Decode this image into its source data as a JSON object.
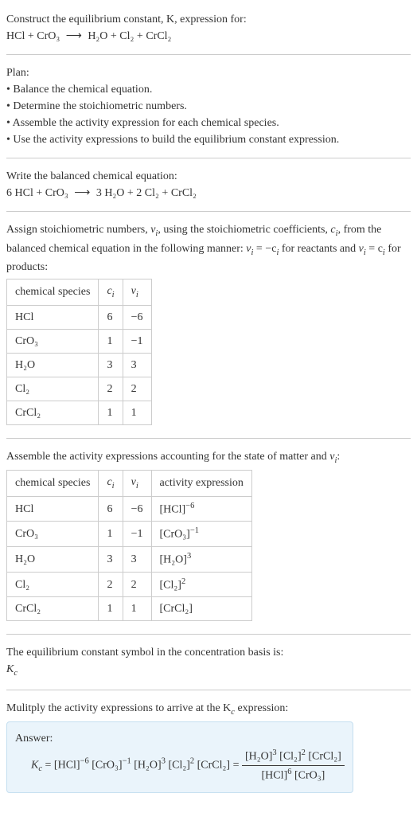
{
  "header": {
    "prompt": "Construct the equilibrium constant, K, expression for:",
    "reaction_lhs": "HCl + CrO₃",
    "reaction_rhs": "H₂O + Cl₂ + CrCl₂"
  },
  "plan": {
    "title": "Plan:",
    "items": [
      "Balance the chemical equation.",
      "Determine the stoichiometric numbers.",
      "Assemble the activity expression for each chemical species.",
      "Use the activity expressions to build the equilibrium constant expression."
    ]
  },
  "balanced": {
    "title": "Write the balanced chemical equation:",
    "lhs": "6 HCl + CrO₃",
    "rhs": "3 H₂O + 2 Cl₂ + CrCl₂"
  },
  "stoich_text": {
    "part1": "Assign stoichiometric numbers, ",
    "nu": "ν",
    "sub_i": "i",
    "part2": ", using the stoichiometric coefficients, ",
    "c": "c",
    "part3": ", from the balanced chemical equation in the following manner: ",
    "eq1": "ν",
    "eq1b": " = −c",
    "part4": " for reactants and ",
    "eq2": "ν",
    "eq2b": " = c",
    "part5": " for products:"
  },
  "table1": {
    "headers": [
      "chemical species",
      "cᵢ",
      "νᵢ"
    ],
    "rows": [
      [
        "HCl",
        "6",
        "−6"
      ],
      [
        "CrO₃",
        "1",
        "−1"
      ],
      [
        "H₂O",
        "3",
        "3"
      ],
      [
        "Cl₂",
        "2",
        "2"
      ],
      [
        "CrCl₂",
        "1",
        "1"
      ]
    ]
  },
  "activity_text": "Assemble the activity expressions accounting for the state of matter and νᵢ:",
  "table2": {
    "headers": [
      "chemical species",
      "cᵢ",
      "νᵢ",
      "activity expression"
    ],
    "rows": [
      {
        "species": "HCl",
        "c": "6",
        "nu": "−6",
        "expr_base": "[HCl]",
        "expr_sup": "−6"
      },
      {
        "species": "CrO₃",
        "c": "1",
        "nu": "−1",
        "expr_base": "[CrO₃]",
        "expr_sup": "−1"
      },
      {
        "species": "H₂O",
        "c": "3",
        "nu": "3",
        "expr_base": "[H₂O]",
        "expr_sup": "3"
      },
      {
        "species": "Cl₂",
        "c": "2",
        "nu": "2",
        "expr_base": "[Cl₂]",
        "expr_sup": "2"
      },
      {
        "species": "CrCl₂",
        "c": "1",
        "nu": "1",
        "expr_base": "[CrCl₂]",
        "expr_sup": ""
      }
    ]
  },
  "symbol_text": "The equilibrium constant symbol in the concentration basis is:",
  "kc": "K",
  "kc_sub": "c",
  "multiply_text": "Mulitply the activity expressions to arrive at the K",
  "multiply_sub": "c",
  "multiply_text2": " expression:",
  "answer": {
    "label": "Answer:",
    "kc": "K",
    "kc_sub": "c",
    "eq": " = ",
    "terms": [
      {
        "base": "[HCl]",
        "sup": "−6"
      },
      {
        "base": " [CrO₃]",
        "sup": "−1"
      },
      {
        "base": " [H₂O]",
        "sup": "3"
      },
      {
        "base": " [Cl₂]",
        "sup": "2"
      },
      {
        "base": " [CrCl₂]",
        "sup": ""
      }
    ],
    "eq2": " = ",
    "frac_num": [
      {
        "base": "[H₂O]",
        "sup": "3"
      },
      {
        "base": " [Cl₂]",
        "sup": "2"
      },
      {
        "base": " [CrCl₂]",
        "sup": ""
      }
    ],
    "frac_den": [
      {
        "base": "[HCl]",
        "sup": "6"
      },
      {
        "base": " [CrO₃]",
        "sup": ""
      }
    ]
  }
}
